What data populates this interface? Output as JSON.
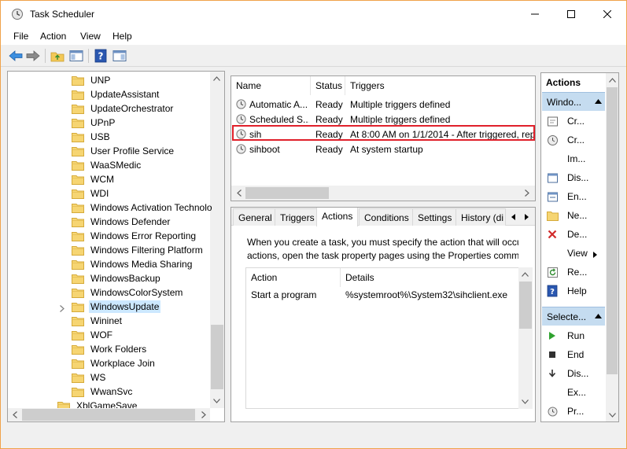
{
  "window": {
    "title": "Task Scheduler"
  },
  "menu": [
    "File",
    "Action",
    "View",
    "Help"
  ],
  "tree": {
    "items": [
      {
        "label": "UNP",
        "selected": false
      },
      {
        "label": "UpdateAssistant",
        "selected": false
      },
      {
        "label": "UpdateOrchestrator",
        "selected": false
      },
      {
        "label": "UPnP",
        "selected": false
      },
      {
        "label": "USB",
        "selected": false
      },
      {
        "label": "User Profile Service",
        "selected": false
      },
      {
        "label": "WaaSMedic",
        "selected": false
      },
      {
        "label": "WCM",
        "selected": false
      },
      {
        "label": "WDI",
        "selected": false
      },
      {
        "label": "Windows Activation Technolo",
        "selected": false
      },
      {
        "label": "Windows Defender",
        "selected": false
      },
      {
        "label": "Windows Error Reporting",
        "selected": false
      },
      {
        "label": "Windows Filtering Platform",
        "selected": false
      },
      {
        "label": "Windows Media Sharing",
        "selected": false
      },
      {
        "label": "WindowsBackup",
        "selected": false
      },
      {
        "label": "WindowsColorSystem",
        "selected": false
      },
      {
        "label": "WindowsUpdate",
        "selected": true
      },
      {
        "label": "Wininet",
        "selected": false
      },
      {
        "label": "WOF",
        "selected": false
      },
      {
        "label": "Work Folders",
        "selected": false
      },
      {
        "label": "Workplace Join",
        "selected": false
      },
      {
        "label": "WS",
        "selected": false
      },
      {
        "label": "WwanSvc",
        "selected": false
      }
    ],
    "parent_item": "XblGameSave"
  },
  "tasks": {
    "columns": [
      "Name",
      "Status",
      "Triggers"
    ],
    "rows": [
      {
        "name": "Automatic A...",
        "status": "Ready",
        "triggers": "Multiple triggers defined"
      },
      {
        "name": "Scheduled S...",
        "status": "Ready",
        "triggers": "Multiple triggers defined"
      },
      {
        "name": "sih",
        "status": "Ready",
        "triggers": "At 8:00 AM on 1/1/2014 - After triggered, rep"
      },
      {
        "name": "sihboot",
        "status": "Ready",
        "triggers": "At system startup"
      }
    ]
  },
  "properties": {
    "tabs": [
      "General",
      "Triggers",
      "Actions",
      "Conditions",
      "Settings",
      "History (di"
    ],
    "active_tab": "Actions",
    "description_line1": "When you create a task, you must specify the action that will occu",
    "description_line2": "actions, open the task property pages using the Properties comm",
    "actions_columns": [
      "Action",
      "Details"
    ],
    "actions_rows": [
      {
        "action": "Start a program",
        "details": "%systemroot%\\System32\\sihclient.exe"
      }
    ]
  },
  "actions_pane": {
    "title": "Actions",
    "section1": "Windo...",
    "section1_items": [
      {
        "label": "Cr...",
        "icon": "create-basic-task-icon"
      },
      {
        "label": "Cr...",
        "icon": "create-task-icon"
      },
      {
        "label": "Im...",
        "icon": "import-icon"
      },
      {
        "label": "Dis...",
        "icon": "display-running-icon"
      },
      {
        "label": "En...",
        "icon": "enable-history-icon"
      },
      {
        "label": "Ne...",
        "icon": "new-folder-icon"
      },
      {
        "label": "De...",
        "icon": "delete-folder-icon"
      },
      {
        "label": "View",
        "icon": "view-submenu"
      },
      {
        "label": "Re...",
        "icon": "refresh-icon"
      },
      {
        "label": "Help",
        "icon": "help-icon"
      }
    ],
    "section2": "Selecte...",
    "section2_items": [
      {
        "label": "Run",
        "icon": "run-icon"
      },
      {
        "label": "End",
        "icon": "end-icon"
      },
      {
        "label": "Dis...",
        "icon": "disable-icon"
      },
      {
        "label": "Ex...",
        "icon": "export-icon"
      },
      {
        "label": "Pr...",
        "icon": "properties-icon"
      }
    ]
  },
  "colors": {
    "highlight_border": "#e0202a",
    "selection": "#cce8ff",
    "section_header": "#c5dcf0"
  }
}
